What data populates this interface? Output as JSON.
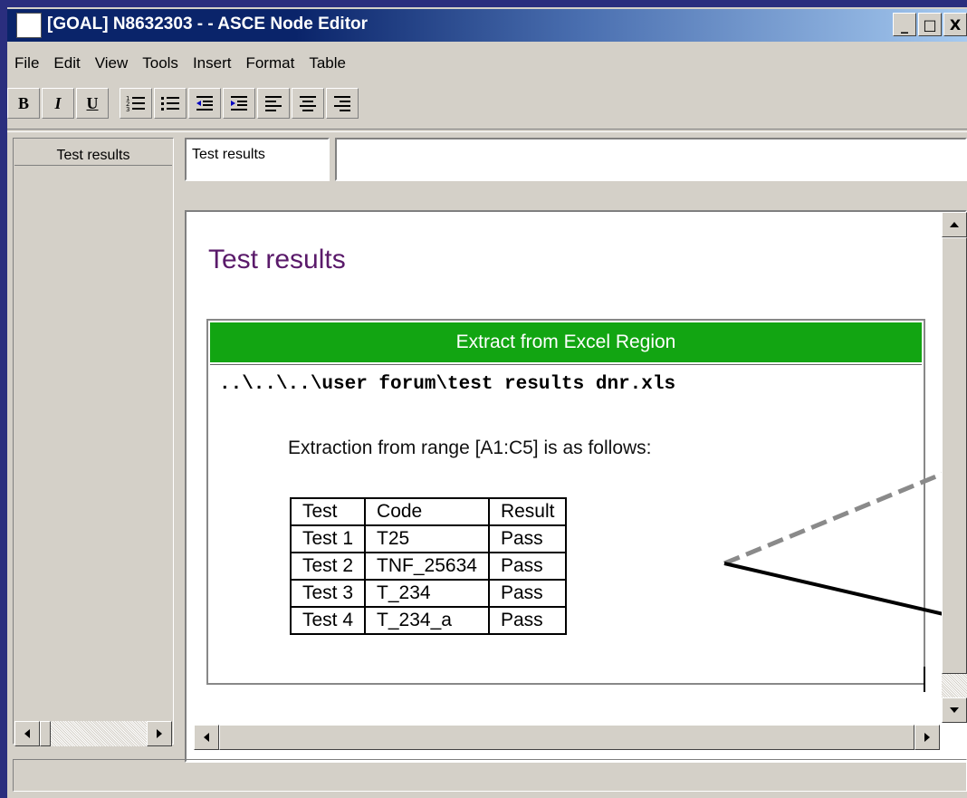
{
  "window": {
    "title": "[GOAL] N8632303 -  - ASCE Node Editor",
    "controls": {
      "minimize": "_",
      "maximize": "□",
      "close": "X"
    }
  },
  "menu": [
    "File",
    "Edit",
    "View",
    "Tools",
    "Insert",
    "Format",
    "Table"
  ],
  "toolbar": {
    "bold": "B",
    "italic": "I",
    "underline": "U",
    "icons": [
      "numbered-list-icon",
      "bullet-list-icon",
      "decrease-indent-icon",
      "increase-indent-icon",
      "align-left-icon",
      "align-center-icon",
      "align-right-icon"
    ]
  },
  "left_pane": {
    "tab_label": "Test results"
  },
  "node_name": "Test results",
  "document": {
    "heading": "Test results",
    "region": {
      "header": "Extract from Excel Region",
      "file_path": "..\\..\\..\\user forum\\test results dnr.xls",
      "extraction_text": "Extraction from range [A1:C5] is as follows:",
      "table": [
        [
          "Test",
          "Code",
          "Result"
        ],
        [
          "Test 1",
          "T25",
          "Pass"
        ],
        [
          "Test 2",
          "TNF_25634",
          "Pass"
        ],
        [
          "Test 3",
          "T_234",
          "Pass"
        ],
        [
          "Test 4",
          "T_234_a",
          "Pass"
        ]
      ]
    }
  },
  "colors": {
    "region_header": "#12a512",
    "heading": "#5a1a6a",
    "titlebar": "#0a246a"
  },
  "status_bar": ""
}
